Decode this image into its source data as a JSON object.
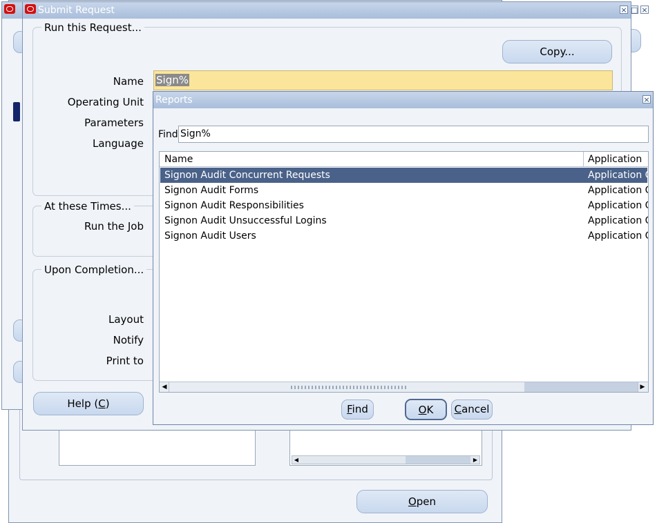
{
  "submit_request": {
    "title": "Submit Request",
    "run_group_title": "Run this Request...",
    "copy_label": "Copy...",
    "name_label": "Name",
    "name_value": "Sign%",
    "operating_unit_label": "Operating Unit",
    "parameters_label": "Parameters",
    "language_label": "Language",
    "times_group_title": "At these Times...",
    "run_job_label": "Run the Job",
    "completion_group_title": "Upon Completion...",
    "layout_label": "Layout",
    "notify_label": "Notify",
    "print_to_label": "Print to",
    "help_label_pre": "Help (",
    "help_key": "C",
    "help_label_post": ")"
  },
  "background_window": {
    "open_key": "O",
    "open_rest": "pen"
  },
  "reports_dialog": {
    "title": "Reports",
    "find_label": "Find",
    "find_value": "Sign%",
    "columns": [
      "Name",
      "Application"
    ],
    "rows": [
      {
        "name": "Signon Audit Concurrent Requests",
        "application": "Application O",
        "selected": true
      },
      {
        "name": "Signon Audit Forms",
        "application": "Application O",
        "selected": false
      },
      {
        "name": "Signon Audit Responsibilities",
        "application": "Application O",
        "selected": false
      },
      {
        "name": "Signon Audit Unsuccessful Logins",
        "application": "Application O",
        "selected": false
      },
      {
        "name": "Signon Audit Users",
        "application": "Application O",
        "selected": false
      }
    ],
    "find_button": {
      "key": "F",
      "rest": "ind"
    },
    "ok_button": {
      "key": "O",
      "rest": "K"
    },
    "cancel_button": {
      "key": "C",
      "rest": "ancel"
    }
  },
  "colors": {
    "title_bar": "#a9bedb",
    "window_bg": "#f0f3f8",
    "selected_row": "#4a6289",
    "name_field_highlight": "#fbe59a",
    "oracle_icon": "#d21010"
  }
}
